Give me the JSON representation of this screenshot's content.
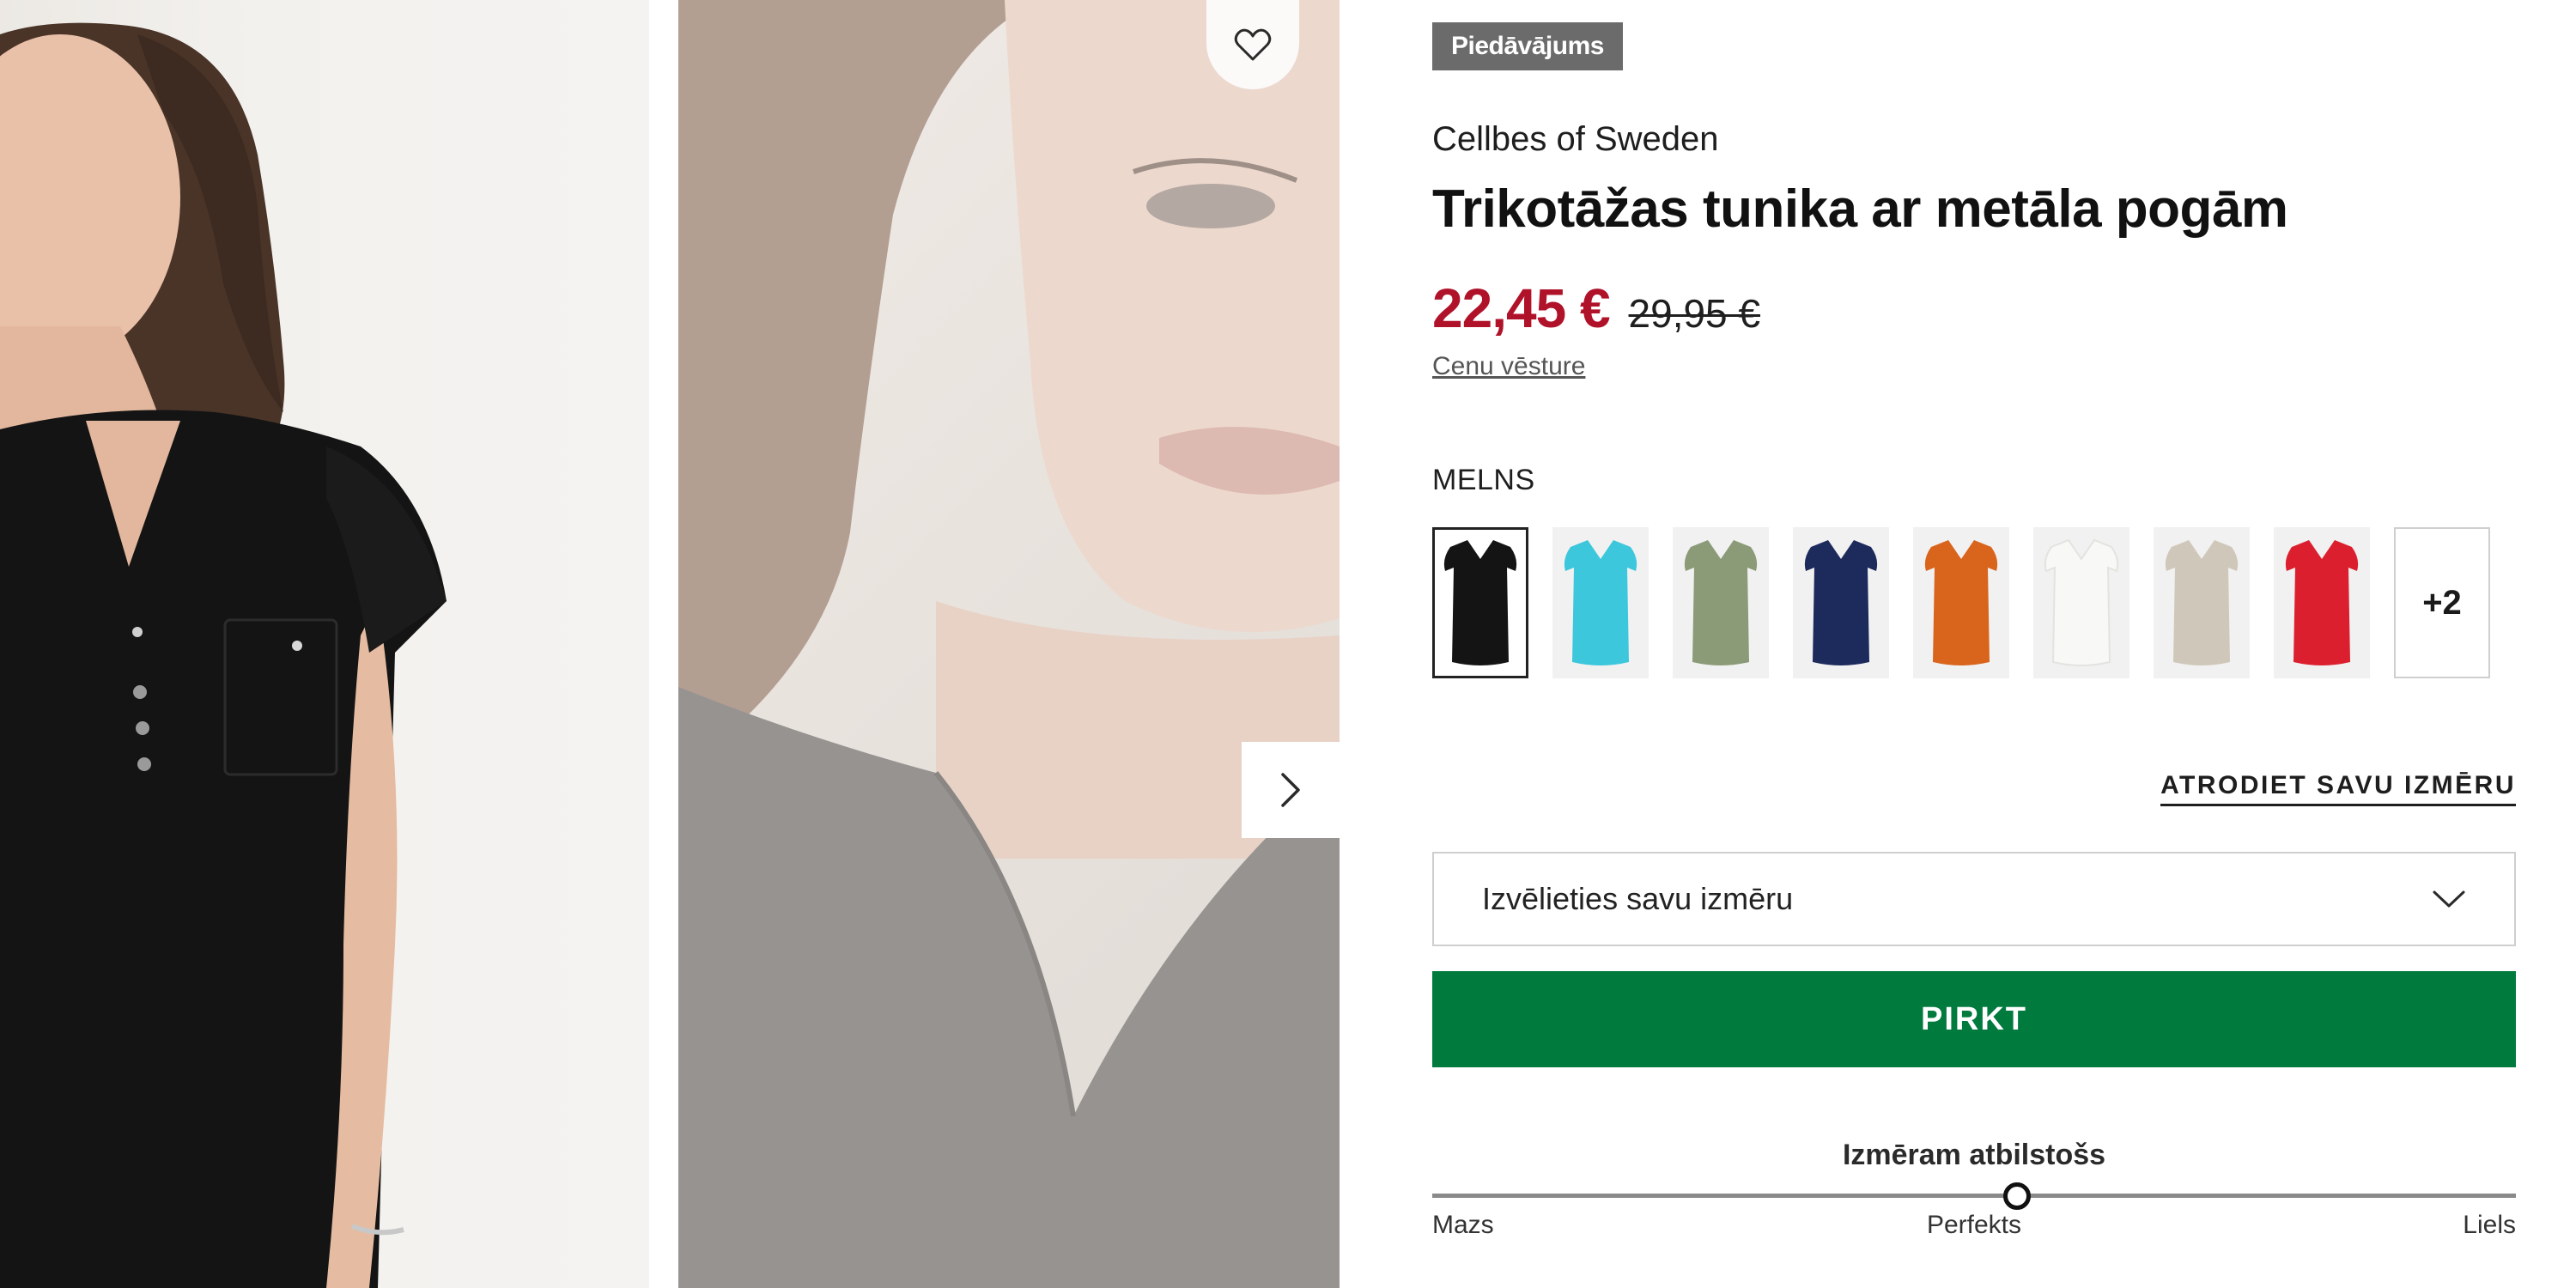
{
  "product": {
    "badge": "Piedāvājums",
    "brand": "Cellbes of Sweden",
    "title": "Trikotāžas tunika ar metāla pogām",
    "price_sale": "22,45 €",
    "price_original": "29,95 €",
    "price_history_link": "Cenu vēsture"
  },
  "colors": {
    "selected_name": "MELNS",
    "swatches": [
      {
        "name": "black",
        "hex": "#141414"
      },
      {
        "name": "turquoise",
        "hex": "#3cc7dc"
      },
      {
        "name": "olive-green",
        "hex": "#8b9a77"
      },
      {
        "name": "navy",
        "hex": "#1d2a5c"
      },
      {
        "name": "orange",
        "hex": "#d9641c"
      },
      {
        "name": "white",
        "hex": "#f8f8f6"
      },
      {
        "name": "beige",
        "hex": "#cfc7ba"
      },
      {
        "name": "red",
        "hex": "#dc1f2e"
      }
    ],
    "more_label": "+2"
  },
  "size": {
    "find_size_link": "ATRODIET SAVU IZMĒRU",
    "select_placeholder": "Izvēlieties savu izmēru",
    "buy_label": "PIRKT"
  },
  "fit": {
    "title": "Izmēram atbilstošs",
    "min_label": "Mazs",
    "mid_label": "Perfekts",
    "max_label": "Liels",
    "position": 0.54
  },
  "theme": {
    "sale_color": "#b0122a",
    "buy_color": "#017a3e",
    "badge_color": "#6b6b6b"
  },
  "icons": {
    "favorite": "heart-icon",
    "next": "chevron-right-icon",
    "select": "chevron-down-icon"
  }
}
